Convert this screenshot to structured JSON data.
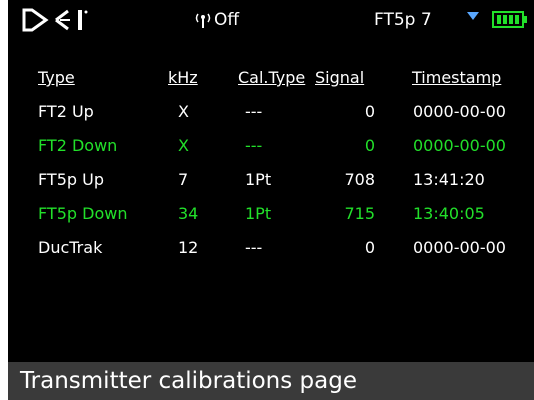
{
  "status_bar": {
    "logo_icon": "dci-logo",
    "radio_status": "Off",
    "transmitter": "FT5p 7",
    "battery_color": "#22e02a"
  },
  "table": {
    "headers": [
      "Type",
      "kHz",
      "Cal.Type",
      "Signal",
      "Timestamp"
    ],
    "rows": [
      {
        "type": "FT2 Up",
        "khz": "X",
        "cal_type": "---",
        "signal": "0",
        "timestamp": "0000-00-00",
        "color": "white"
      },
      {
        "type": "FT2 Down",
        "khz": "X",
        "cal_type": "---",
        "signal": "0",
        "timestamp": "0000-00-00",
        "color": "green"
      },
      {
        "type": "FT5p Up",
        "khz": "7",
        "cal_type": "1Pt",
        "signal": "708",
        "timestamp": "13:41:20",
        "color": "white"
      },
      {
        "type": "FT5p Down",
        "khz": "34",
        "cal_type": "1Pt",
        "signal": "715",
        "timestamp": "13:40:05",
        "color": "green"
      },
      {
        "type": "DucTrak",
        "khz": "12",
        "cal_type": "---",
        "signal": "0",
        "timestamp": "0000-00-00",
        "color": "white"
      }
    ]
  },
  "footer": {
    "title": "Transmitter calibrations page"
  },
  "colors": {
    "text": "#ffffff",
    "highlight": "#22e02a",
    "footer_bg": "#3a3a3a",
    "dropdown": "#5aa8ff"
  }
}
